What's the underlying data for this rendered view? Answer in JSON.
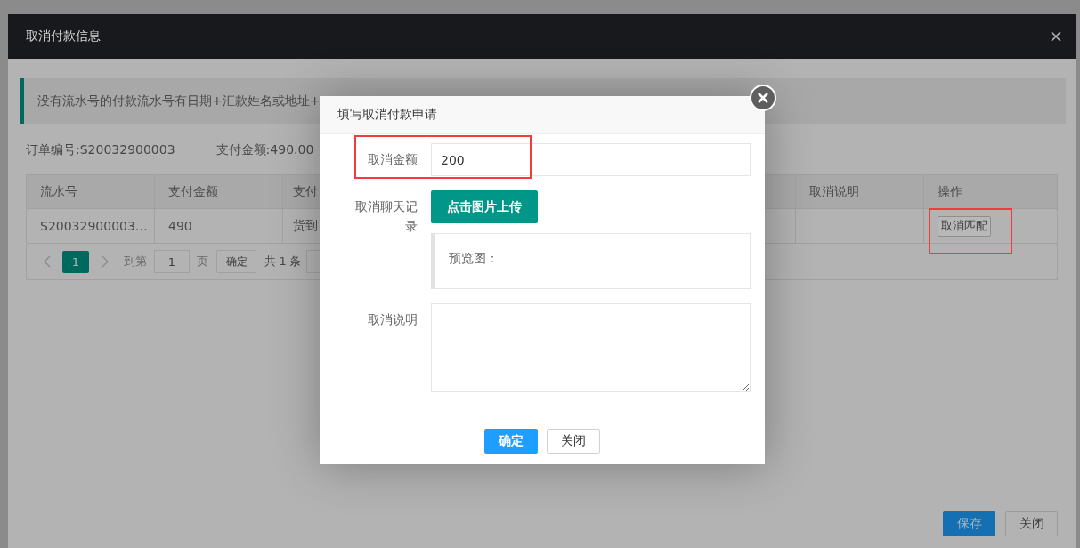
{
  "dialog": {
    "title": "取消付款信息",
    "notice": "没有流水号的付款流水号有日期+汇款姓名或地址+",
    "order_number": "订单编号:S20032900003",
    "payment_amount": "支付金额:490.00",
    "table": {
      "columns": [
        "流水号",
        "支付金额",
        "支付",
        "取消说明",
        "操作"
      ],
      "rows": [
        {
          "cells": [
            "S20032900003…",
            "490",
            "货到"
          ],
          "action": {
            "label": "取消匹配",
            "highlighted": true
          }
        }
      ]
    },
    "pagination": {
      "prev": {
        "disabled": true
      },
      "pages": [
        {
          "label": "1",
          "selected": true
        }
      ],
      "next": {
        "disabled": true
      },
      "goto_label": "到第",
      "goto_value": "1",
      "page_unit": "页",
      "confirm": "确定",
      "total": "共 1 条"
    },
    "buttons": [
      {
        "label": "保存",
        "kind": "primary"
      },
      {
        "label": "关闭",
        "kind": "default"
      }
    ]
  },
  "popup": {
    "title": "填写取消付款申请",
    "fields": [
      {
        "kind": "input",
        "label": "取消金额",
        "value": "200",
        "highlighted": true
      },
      {
        "kind": "upload",
        "label": "取消聊天记录",
        "button": "点击图片上传",
        "preview_label": "预览图："
      },
      {
        "kind": "textarea",
        "label": "取消说明"
      }
    ],
    "buttons": [
      {
        "label": "确定",
        "kind": "primary"
      },
      {
        "label": "关闭",
        "kind": "default"
      }
    ]
  }
}
